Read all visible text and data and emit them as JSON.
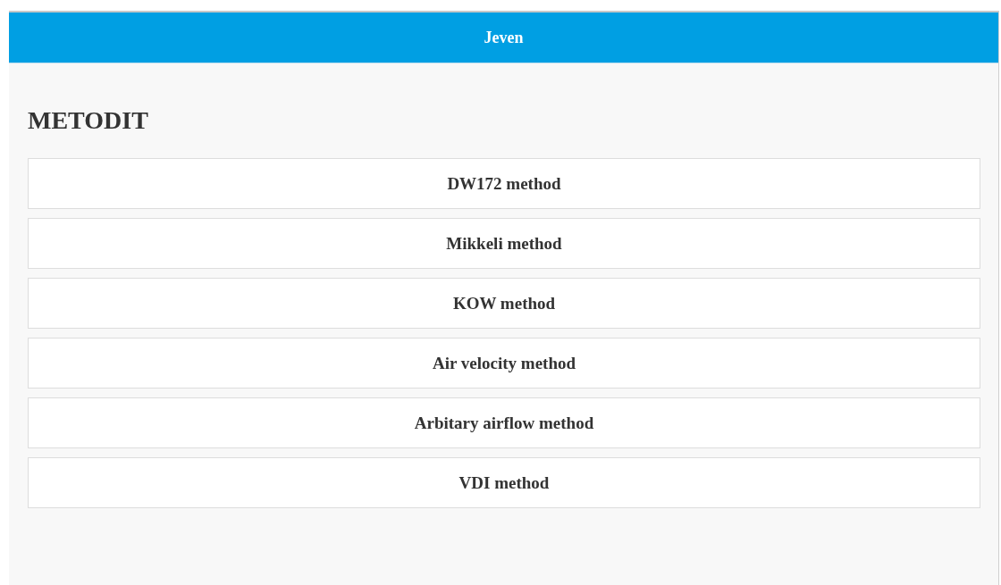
{
  "header": {
    "title": "Jeven"
  },
  "section": {
    "title": "METODIT"
  },
  "methods": [
    {
      "label": "DW172 method"
    },
    {
      "label": "Mikkeli method"
    },
    {
      "label": "KOW method"
    },
    {
      "label": "Air velocity method"
    },
    {
      "label": "Arbitary airflow method"
    },
    {
      "label": "VDI method"
    }
  ]
}
